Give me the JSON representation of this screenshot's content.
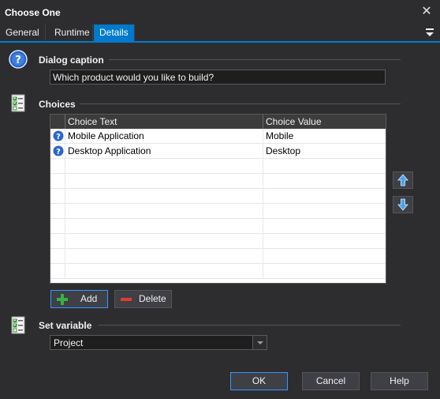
{
  "window": {
    "title": "Choose One",
    "close_glyph": "✕"
  },
  "tabs": [
    {
      "label": "General",
      "active": false
    },
    {
      "label": "Runtime",
      "active": false
    },
    {
      "label": "Details",
      "active": true
    }
  ],
  "dialog_caption": {
    "label": "Dialog caption",
    "value": "Which product would you like to build?",
    "icon": "help-icon"
  },
  "choices": {
    "label": "Choices",
    "icon": "checklist-icon",
    "columns": [
      "Choice Text",
      "Choice Value"
    ],
    "rows": [
      {
        "text": "Mobile Application",
        "value": "Mobile",
        "icon": "question-icon"
      },
      {
        "text": "Desktop Application",
        "value": "Desktop",
        "icon": "question-icon"
      }
    ],
    "add_label": "Add",
    "delete_label": "Delete"
  },
  "set_variable": {
    "label": "Set variable",
    "icon": "checklist-icon",
    "selected": "Project"
  },
  "footer": {
    "ok_label": "OK",
    "cancel_label": "Cancel",
    "help_label": "Help"
  },
  "colors": {
    "accent": "#007acc",
    "background": "#2d2d30",
    "add_green": "#3cb043",
    "delete_red": "#e03c31"
  }
}
